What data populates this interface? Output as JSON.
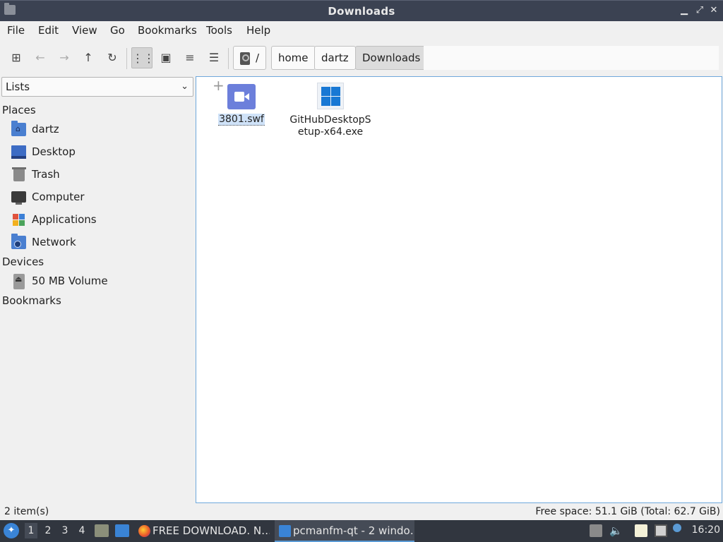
{
  "window": {
    "title": "Downloads"
  },
  "menu": {
    "file": "File",
    "edit": "Edit",
    "view": "View",
    "go": "Go",
    "bookmarks": "Bookmarks",
    "tools": "Tools",
    "help": "Help"
  },
  "path": {
    "root": "/",
    "crumbs": [
      "home",
      "dartz",
      "Downloads"
    ]
  },
  "sidebar": {
    "mode": "Lists",
    "places_header": "Places",
    "places": [
      {
        "label": "dartz",
        "icon": "user-home-folder-icon"
      },
      {
        "label": "Desktop",
        "icon": "desktop-icon"
      },
      {
        "label": "Trash",
        "icon": "trash-icon"
      },
      {
        "label": "Computer",
        "icon": "computer-icon"
      },
      {
        "label": "Applications",
        "icon": "applications-icon"
      },
      {
        "label": "Network",
        "icon": "network-folder-icon"
      }
    ],
    "devices_header": "Devices",
    "devices": [
      {
        "label": "50 MB Volume",
        "icon": "removable-drive-icon"
      }
    ],
    "bookmarks_header": "Bookmarks"
  },
  "files": [
    {
      "name": "3801.swf",
      "icon": "video-file-icon",
      "selected": true
    },
    {
      "name_line1": "GitHubDesktopS",
      "name_line2": "etup-x64.exe",
      "icon": "windows-executable-icon",
      "selected": false
    }
  ],
  "status": {
    "items": "2 item(s)",
    "free_space": "Free space: 51.1 GiB (Total: 62.7 GiB)"
  },
  "taskbar": {
    "workspaces": [
      "1",
      "2",
      "3",
      "4"
    ],
    "tasks": [
      {
        "label": "FREE DOWNLOAD. N…",
        "icon": "firefox-icon"
      },
      {
        "label": "pcmanfm-qt - 2 windo…",
        "icon": "file-manager-icon"
      }
    ],
    "clock": "16:20"
  },
  "colors": {
    "accent": "#6fa8dc",
    "selection": "#cfe2f8",
    "taskbar": "#31363f",
    "titlebar": "#3b4252"
  }
}
